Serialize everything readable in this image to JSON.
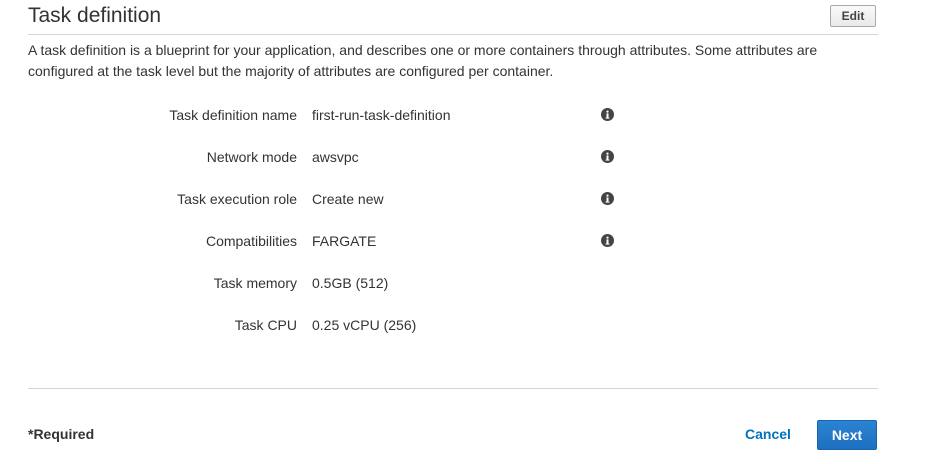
{
  "section": {
    "title": "Task definition",
    "edit_label": "Edit",
    "description": "A task definition is a blueprint for your application, and describes one or more containers through attributes. Some attributes are configured at the task level but the majority of attributes are configured per container."
  },
  "fields": [
    {
      "label": "Task definition name",
      "value": "first-run-task-definition",
      "icon": "info-icon"
    },
    {
      "label": "Network mode",
      "value": "awsvpc",
      "icon": "info-icon"
    },
    {
      "label": "Task execution role",
      "value": "Create new",
      "icon": "info-icon"
    },
    {
      "label": "Compatibilities",
      "value": "FARGATE",
      "icon": "info-icon"
    },
    {
      "label": "Task memory",
      "value": "0.5GB (512)"
    },
    {
      "label": "Task CPU",
      "value": "0.25 vCPU (256)"
    }
  ],
  "footer": {
    "required_label": "*Required",
    "cancel_label": "Cancel",
    "next_label": "Next"
  },
  "colors": {
    "link": "#0073bb",
    "primary_button": "#1e6fbf"
  }
}
